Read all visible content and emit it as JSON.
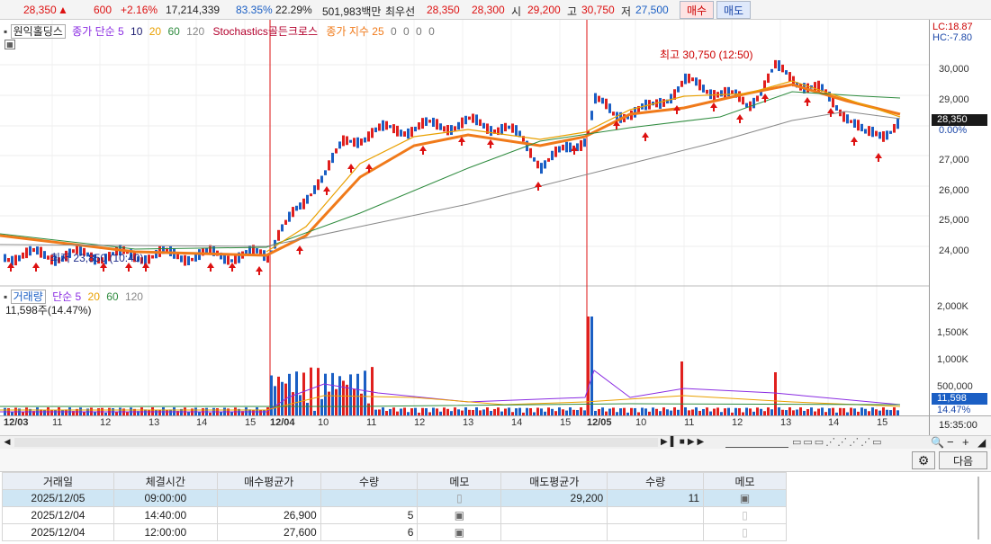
{
  "quote": {
    "price": "28,350",
    "arrow": "▲",
    "change": "600",
    "rate": "+2.16%",
    "volume": "17,214,339",
    "vol_ratio": "83.35%",
    "turnover": "22.29%",
    "amount": "501,983백만",
    "best_label": "최우선",
    "ask": "28,350",
    "bid": "28,300",
    "open_label": "시",
    "open": "29,200",
    "high_label": "고",
    "high": "30,750",
    "low_label": "저",
    "low": "27,500",
    "buy_label": "매수",
    "sell_label": "매도"
  },
  "chart": {
    "price_legend": {
      "name": "원익홀딩스",
      "ma_label": "종가 단순",
      "ma": [
        "5",
        "10",
        "20",
        "60",
        "120"
      ],
      "stoch": "Stochastics골든크로스",
      "ema_label": "종가 지수",
      "ema": [
        "25",
        "0",
        "0",
        "0",
        "0"
      ]
    },
    "lc": "LC:18.87",
    "hc": "HC:-7.80",
    "price_ticks": [
      "30,000",
      "29,000",
      "28,000",
      "27,000",
      "26,000",
      "25,000",
      "24,000"
    ],
    "current_price": "28,350",
    "current_pct": "0.00%",
    "high_annot": "최고 30,750 (12:50)",
    "low_annot": "최저 23,850 (10:40)",
    "vol_legend": {
      "name": "거래량",
      "ma_label": "단순",
      "ma": [
        "5",
        "20",
        "60",
        "120"
      ]
    },
    "vol_current": "11,598주(14.47%)",
    "vol_ticks": [
      "2,000K",
      "1,500K",
      "1,000K",
      "500,000"
    ],
    "vol_tag": "11,598",
    "vol_pct": "14.47%",
    "x_labels": [
      "12/03",
      "11",
      "12",
      "13",
      "14",
      "15",
      "12/04",
      "10",
      "11",
      "12",
      "13",
      "14",
      "15",
      "12/05",
      "10",
      "11",
      "12",
      "13",
      "14",
      "15"
    ],
    "time_label": "15:35:00",
    "colors": {
      "up": "#e0201e",
      "down": "#1b5fc4",
      "ma5": "#8a2be2",
      "ma10": "#1a1a6e",
      "ma20": "#e9a000",
      "ma60": "#2e8b3e",
      "ma120": "#888888",
      "ema": "#f07a1a"
    }
  },
  "trades": {
    "headers": [
      "거래일",
      "체결시간",
      "매수평균가",
      "수량",
      "메모",
      "매도평균가",
      "수량",
      "메모"
    ],
    "rows": [
      {
        "date": "2025/12/05",
        "time": "09:00:00",
        "buy_avg": "",
        "buy_qty": "",
        "sell_avg": "29,200",
        "sell_qty": "11"
      },
      {
        "date": "2025/12/04",
        "time": "14:40:00",
        "buy_avg": "26,900",
        "buy_qty": "5",
        "sell_avg": "",
        "sell_qty": ""
      },
      {
        "date": "2025/12/04",
        "time": "12:00:00",
        "buy_avg": "27,600",
        "buy_qty": "6",
        "sell_avg": "",
        "sell_qty": ""
      }
    ]
  },
  "toolbar": {
    "next_label": "다음"
  }
}
